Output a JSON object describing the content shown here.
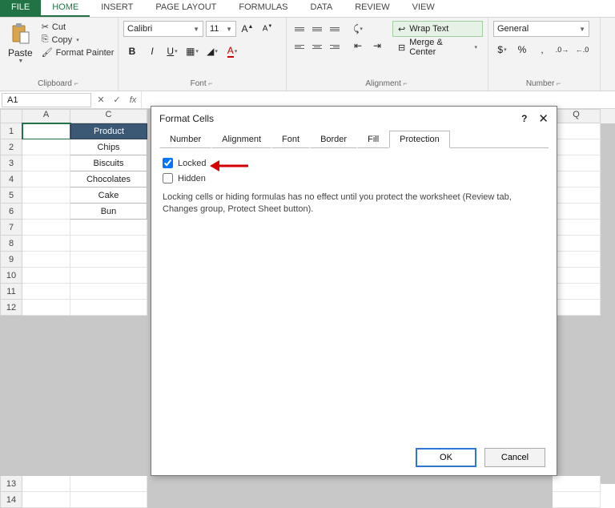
{
  "tabs": {
    "file": "FILE",
    "items": [
      "HOME",
      "INSERT",
      "PAGE LAYOUT",
      "FORMULAS",
      "DATA",
      "REVIEW",
      "VIEW"
    ],
    "active": "HOME"
  },
  "ribbon": {
    "clipboard": {
      "paste": "Paste",
      "cut": "Cut",
      "copy": "Copy",
      "format_painter": "Format Painter",
      "label": "Clipboard"
    },
    "font": {
      "name": "Calibri",
      "size": "11",
      "label": "Font"
    },
    "alignment": {
      "wrap": "Wrap Text",
      "merge": "Merge & Center",
      "label": "Alignment"
    },
    "number": {
      "format": "General",
      "label": "Number"
    }
  },
  "namebox": "A1",
  "columns": [
    {
      "letter": "A",
      "w": 60
    },
    {
      "letter": "C",
      "w": 96
    }
  ],
  "col_q": "Q",
  "row_numbers": [
    1,
    2,
    3,
    4,
    5,
    6,
    7,
    8,
    9,
    10,
    11,
    12,
    "",
    "",
    "",
    "",
    "",
    "",
    "",
    "",
    "",
    "",
    13,
    14
  ],
  "table": {
    "header": "Product",
    "rows": [
      "Chips",
      "Biscuits",
      "Chocolates",
      "Cake",
      "Bun"
    ]
  },
  "dialog": {
    "title": "Format Cells",
    "tabs": [
      "Number",
      "Alignment",
      "Font",
      "Border",
      "Fill",
      "Protection"
    ],
    "active_tab": "Protection",
    "locked_label": "Locked",
    "locked_checked": true,
    "hidden_label": "Hidden",
    "hidden_checked": false,
    "help_text": "Locking cells or hiding formulas has no effect until you protect the worksheet (Review tab, Changes group, Protect Sheet button).",
    "ok": "OK",
    "cancel": "Cancel"
  }
}
